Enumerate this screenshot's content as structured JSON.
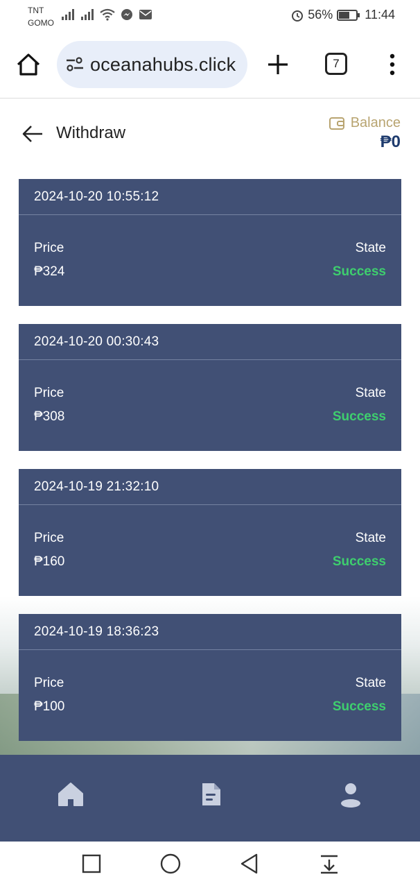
{
  "status_bar": {
    "carrier_line1": "TNT",
    "carrier_line2": "GOMO",
    "battery": "56%",
    "time": "11:44"
  },
  "browser": {
    "url": "oceanahubs.click",
    "tab_count": "7"
  },
  "header": {
    "title": "Withdraw",
    "balance_label": "Balance",
    "balance_value": "₱0"
  },
  "records": [
    {
      "datetime": "2024-10-20 10:55:12",
      "price_label": "Price",
      "price": "₱324",
      "state_label": "State",
      "state": "Success"
    },
    {
      "datetime": "2024-10-20 00:30:43",
      "price_label": "Price",
      "price": "₱308",
      "state_label": "State",
      "state": "Success"
    },
    {
      "datetime": "2024-10-19 21:32:10",
      "price_label": "Price",
      "price": "₱160",
      "state_label": "State",
      "state": "Success"
    },
    {
      "datetime": "2024-10-19 18:36:23",
      "price_label": "Price",
      "price": "₱100",
      "state_label": "State",
      "state": "Success"
    }
  ],
  "tab_bar": {
    "items": [
      {
        "icon": "home-icon"
      },
      {
        "icon": "document-icon"
      },
      {
        "icon": "user-icon"
      }
    ]
  },
  "colors": {
    "card_bg": "#415075",
    "success": "#3ecf6e",
    "balance_value": "#1f3c6e",
    "balance_label": "#b8a470"
  }
}
